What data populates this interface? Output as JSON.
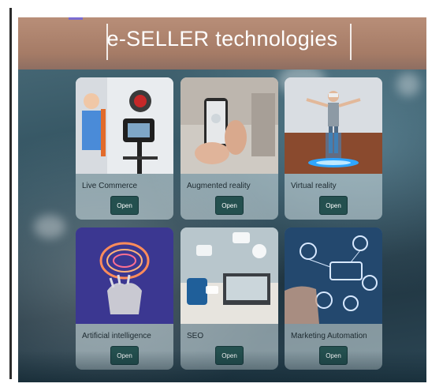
{
  "header": {
    "title": "e-SELLER technologies"
  },
  "cards": [
    {
      "label": "Live Commerce",
      "button": "Open",
      "image": "live-commerce-image"
    },
    {
      "label": "Augmented reality",
      "button": "Open",
      "image": "augmented-reality-image"
    },
    {
      "label": "Virtual reality",
      "button": "Open",
      "image": "virtual-reality-image"
    },
    {
      "label": "Artificial intelligence",
      "button": "Open",
      "image": "artificial-intelligence-image"
    },
    {
      "label": "SEO",
      "button": "Open",
      "image": "seo-image"
    },
    {
      "label": "Marketing Automation",
      "button": "Open",
      "image": "marketing-automation-image"
    }
  ],
  "colors": {
    "header_bg": "#a57b66",
    "button_bg": "#24504f",
    "accent": "#7b6bd0"
  }
}
